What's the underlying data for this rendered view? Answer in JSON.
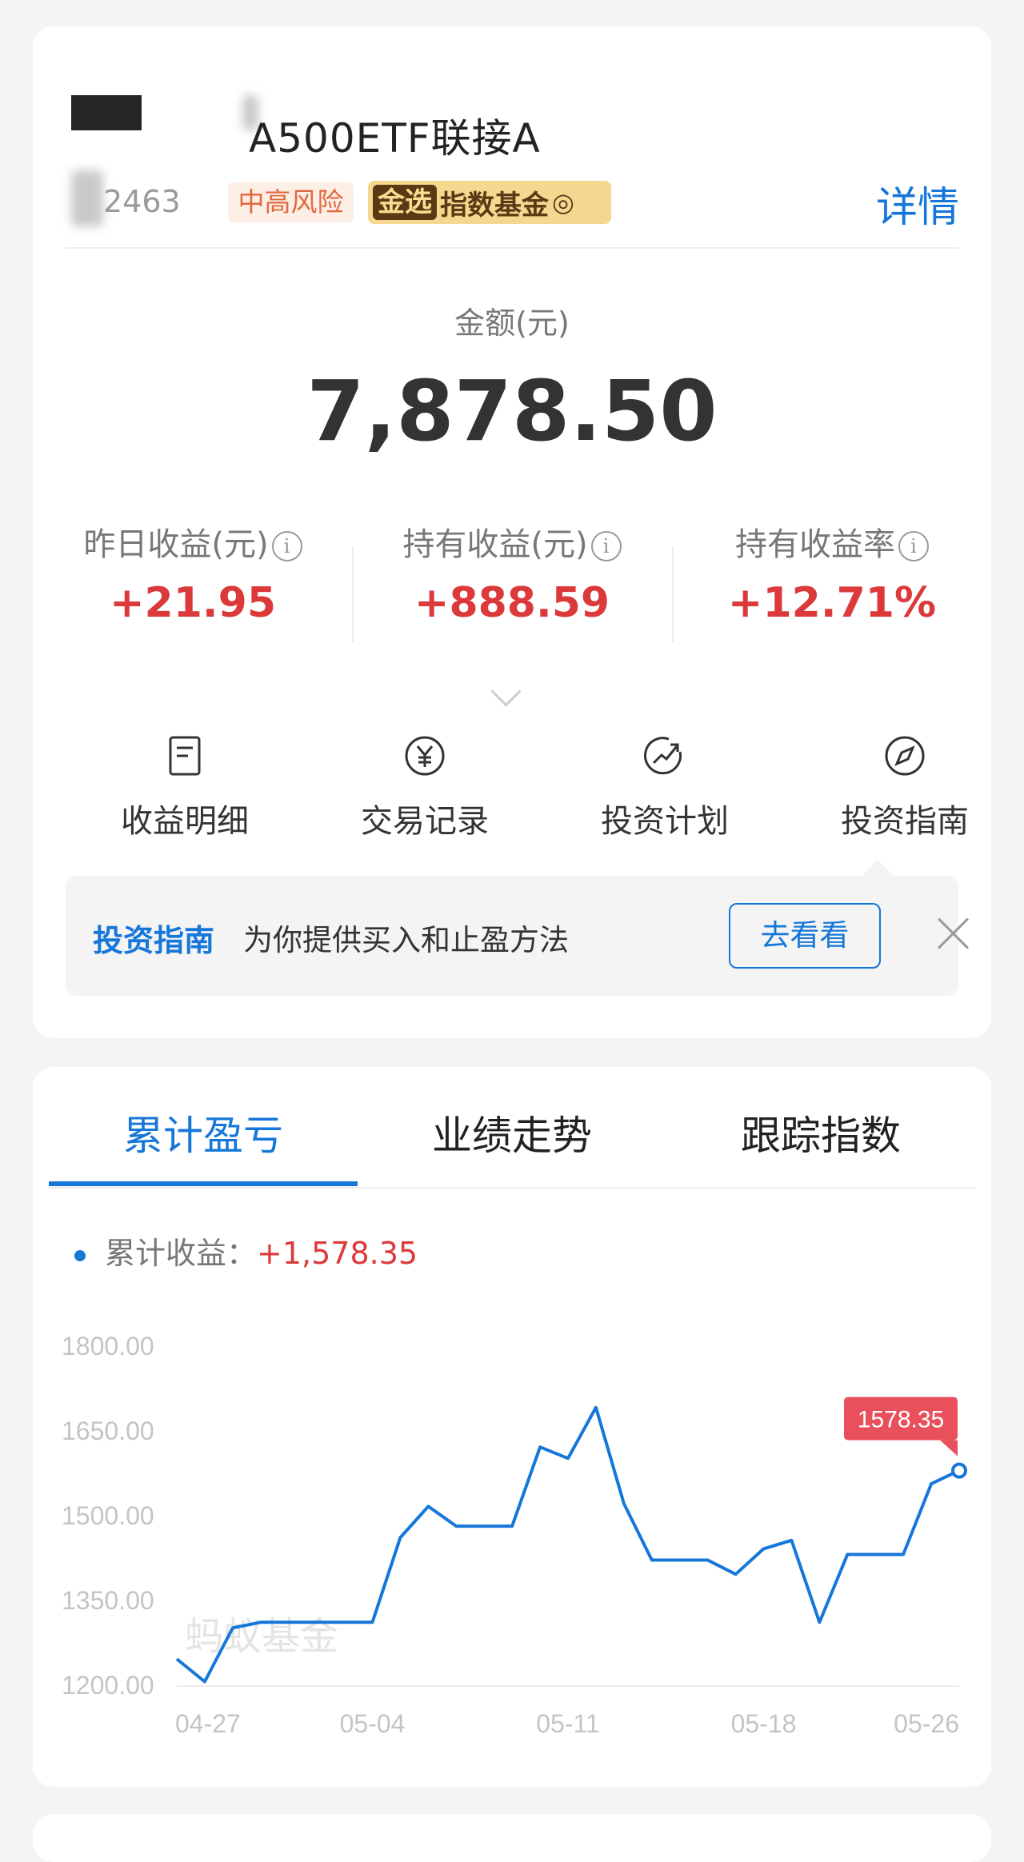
{
  "fund": {
    "name": "A500ETF联接A",
    "code": "2463",
    "risk_level": "中高风险",
    "badge_gold": "金选",
    "badge_label": "指数基金",
    "detail_link": "详情"
  },
  "amount": {
    "label": "金额(元)",
    "value": "7,878.50"
  },
  "stats": [
    {
      "label": "昨日收益(元)",
      "value": "+21.95"
    },
    {
      "label": "持有收益(元)",
      "value": "+888.59"
    },
    {
      "label": "持有收益率",
      "value": "+12.71%"
    }
  ],
  "actions": [
    {
      "label": "收益明细",
      "icon": "document-icon"
    },
    {
      "label": "交易记录",
      "icon": "yuan-circle-icon"
    },
    {
      "label": "投资计划",
      "icon": "trend-up-icon"
    },
    {
      "label": "投资指南",
      "icon": "compass-icon"
    }
  ],
  "guide_banner": {
    "title": "投资指南",
    "description": "为你提供买入和止盈方法",
    "button": "去看看"
  },
  "tabs": [
    "累计盈亏",
    "业绩走势",
    "跟踪指数"
  ],
  "active_tab": 0,
  "legend": {
    "label": "累计收益：",
    "value": "+1,578.35"
  },
  "watermark": "蚂蚁基金",
  "colors": {
    "accent": "#1677d9",
    "gain": "#dc3a3a",
    "tooltip_bg": "#e8505b"
  },
  "chart_data": {
    "type": "line",
    "series": [
      {
        "name": "累计收益",
        "values": [
          1245,
          1205,
          1300,
          1310,
          1310,
          1310,
          1310,
          1310,
          1460,
          1515,
          1480,
          1480,
          1480,
          1620,
          1600,
          1690,
          1520,
          1420,
          1420,
          1420,
          1395,
          1440,
          1455,
          1310,
          1430,
          1430,
          1430,
          1555,
          1578.35
        ]
      }
    ],
    "x_ticks": [
      "04-27",
      "05-04",
      "05-11",
      "05-18",
      "05-26"
    ],
    "y_ticks": [
      "1800.00",
      "1650.00",
      "1500.00",
      "1350.00",
      "1200.00"
    ],
    "ylim": [
      1200,
      1800
    ],
    "grid": false,
    "last_point_label": "1578.35"
  }
}
